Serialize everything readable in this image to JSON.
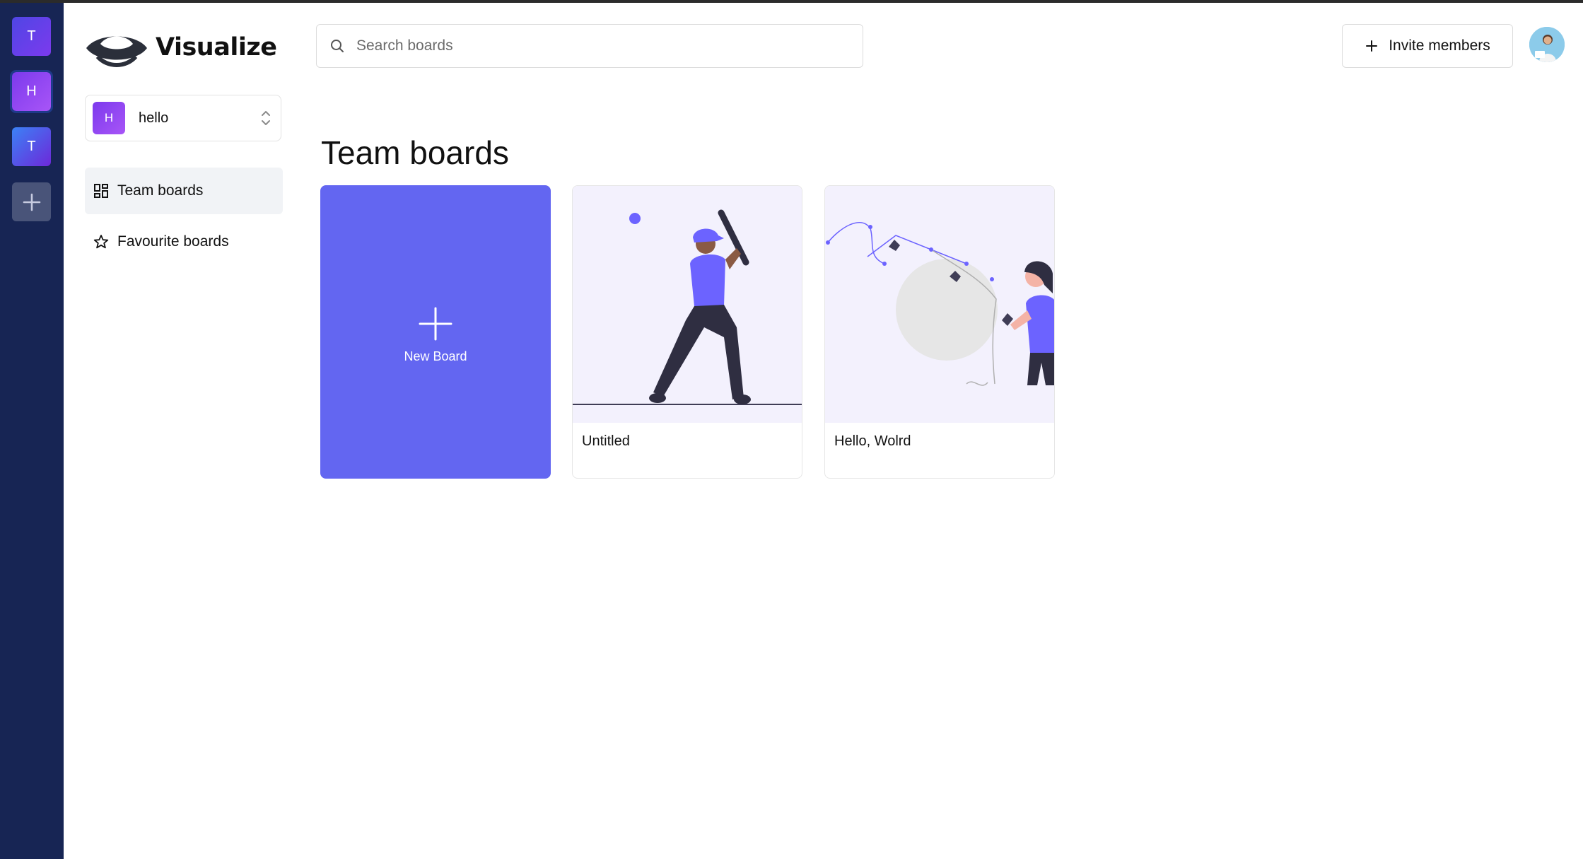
{
  "org_switcher": {
    "orgs": [
      {
        "initial": "T"
      },
      {
        "initial": "H"
      },
      {
        "initial": "T"
      }
    ],
    "add_icon": "plus-icon"
  },
  "brand": {
    "name": "Visualize",
    "logo_icon": "visualize-logo"
  },
  "sidebar": {
    "current_org": {
      "initial": "H",
      "name": "hello"
    },
    "items": [
      {
        "label": "Team boards",
        "icon": "dashboard-grid-icon",
        "active": true
      },
      {
        "label": "Favourite boards",
        "icon": "star-icon",
        "active": false
      }
    ]
  },
  "header": {
    "search": {
      "placeholder": "Search boards",
      "value": ""
    },
    "invite_label": "Invite members"
  },
  "main": {
    "title": "Team boards",
    "new_board_label": "New Board",
    "boards": [
      {
        "title": "Untitled",
        "thumbnail": "baseball-player-illustration"
      },
      {
        "title": "Hello, Wolrd",
        "thumbnail": "woman-drawing-curves-illustration"
      }
    ]
  },
  "colors": {
    "org_rail": "#172554",
    "accent": "#6366f1",
    "thumbnail_bg": "#f3f1fd"
  }
}
